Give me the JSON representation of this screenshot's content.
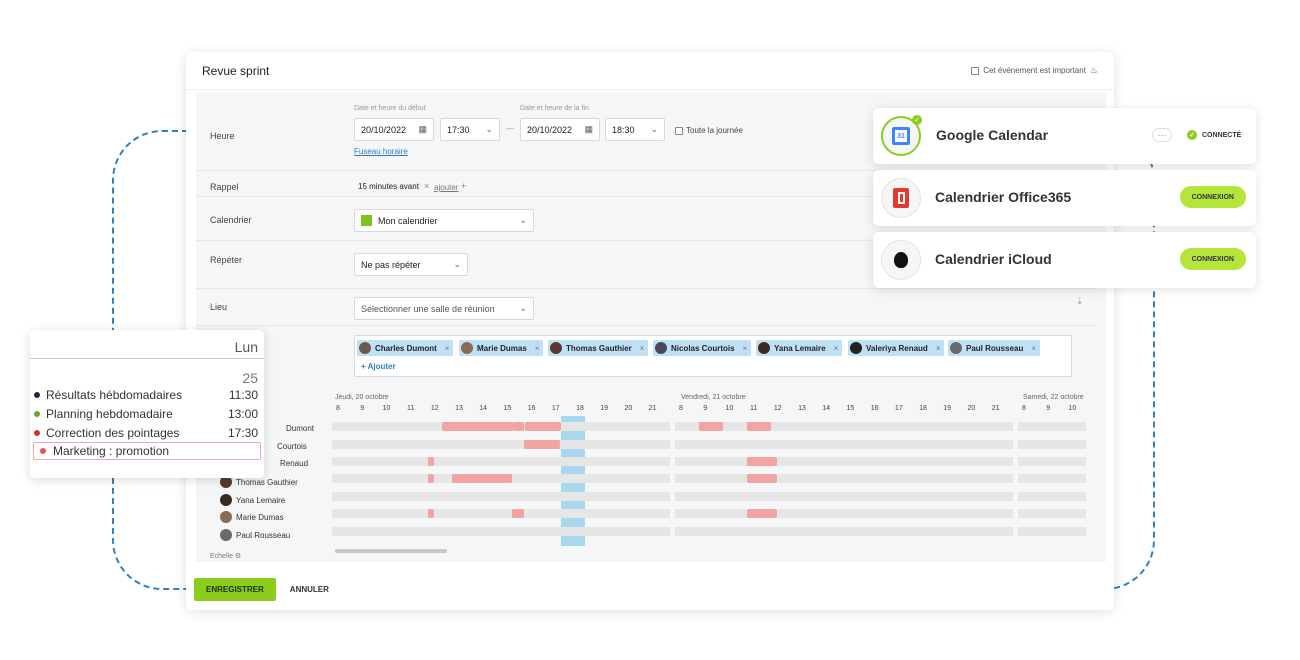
{
  "main": {
    "title": "Revue sprint",
    "important_label": "Cet événement est important",
    "heure_label": "Heure",
    "start_label": "Date et heure du début",
    "end_label": "Date et heure de la fin",
    "start_date": "20/10/2022",
    "start_time": "17:30",
    "end_date": "20/10/2022",
    "end_time": "18:30",
    "allday_label": "Toute la journée",
    "dash": "—",
    "timezone_link": "Fuseau horaire",
    "rappel_label": "Rappel",
    "rappel_value": "15 minutes avant",
    "rappel_add": "ajouter",
    "calendrier_label": "Calendrier",
    "calendrier_value": "Mon calendrier",
    "repeter_label": "Répéter",
    "repeter_value": "Ne pas répéter",
    "lieu_label": "Lieu",
    "lieu_placeholder": "Sélectionner une salle de réunion",
    "participants": [
      "Charles Dumont",
      "Marie Dumas",
      "Thomas Gauthier",
      "Nicolas Courtois",
      "Yana Lemaire",
      "Valeriya Renaud",
      "Paul Rousseau"
    ],
    "add_participant": "+ Ajouter",
    "day1": "Jeudi, 20 octobre",
    "day2": "Vendredi, 21 octobre",
    "day3": "Samedi, 22 octobre",
    "hours_day1": [
      "8",
      "9",
      "10",
      "11",
      "12",
      "13",
      "14",
      "15",
      "16",
      "17",
      "18",
      "19",
      "20",
      "21"
    ],
    "hours_day2": [
      "8",
      "9",
      "10",
      "11",
      "12",
      "13",
      "14",
      "15",
      "16",
      "17",
      "18",
      "19",
      "20",
      "21"
    ],
    "hours_day3": [
      "8",
      "9",
      "10"
    ],
    "row_names": [
      "Dumont",
      "Courtois",
      "Renaud",
      "Thomas Gauthier",
      "Yana Lemaire",
      "Marie Dumas",
      "Paul Rousseau"
    ],
    "echelle": "Echelle",
    "save": "ENREGISTRER",
    "cancel": "ANNULER"
  },
  "calendars": {
    "google": {
      "name": "Google Calendar",
      "status": "CONNECTÉ",
      "icon_text": "31"
    },
    "office": {
      "name": "Calendrier Office365",
      "button": "CONNEXION"
    },
    "icloud": {
      "name": "Calendrier iCloud",
      "button": "CONNEXION"
    }
  },
  "agenda": {
    "day": "Lun",
    "date": "25",
    "events": [
      {
        "label": "Résultats hébdomadaires",
        "time": "11:30",
        "color": "#1b2a4e"
      },
      {
        "label": "Planning hebdomadaire",
        "time": "13:00",
        "color": "#6aa334"
      },
      {
        "label": "Correction des pointages",
        "time": "17:30",
        "color": "#d32f2f"
      },
      {
        "label": "Marketing : promotion",
        "time": "",
        "color": "#e25555"
      }
    ]
  },
  "colors": {
    "accent_green": "#8ccc1c",
    "connect_green": "#b5e53b",
    "busy": "#f4a3a3",
    "highlight": "#a8d8f0",
    "link": "#2f7fc1"
  }
}
